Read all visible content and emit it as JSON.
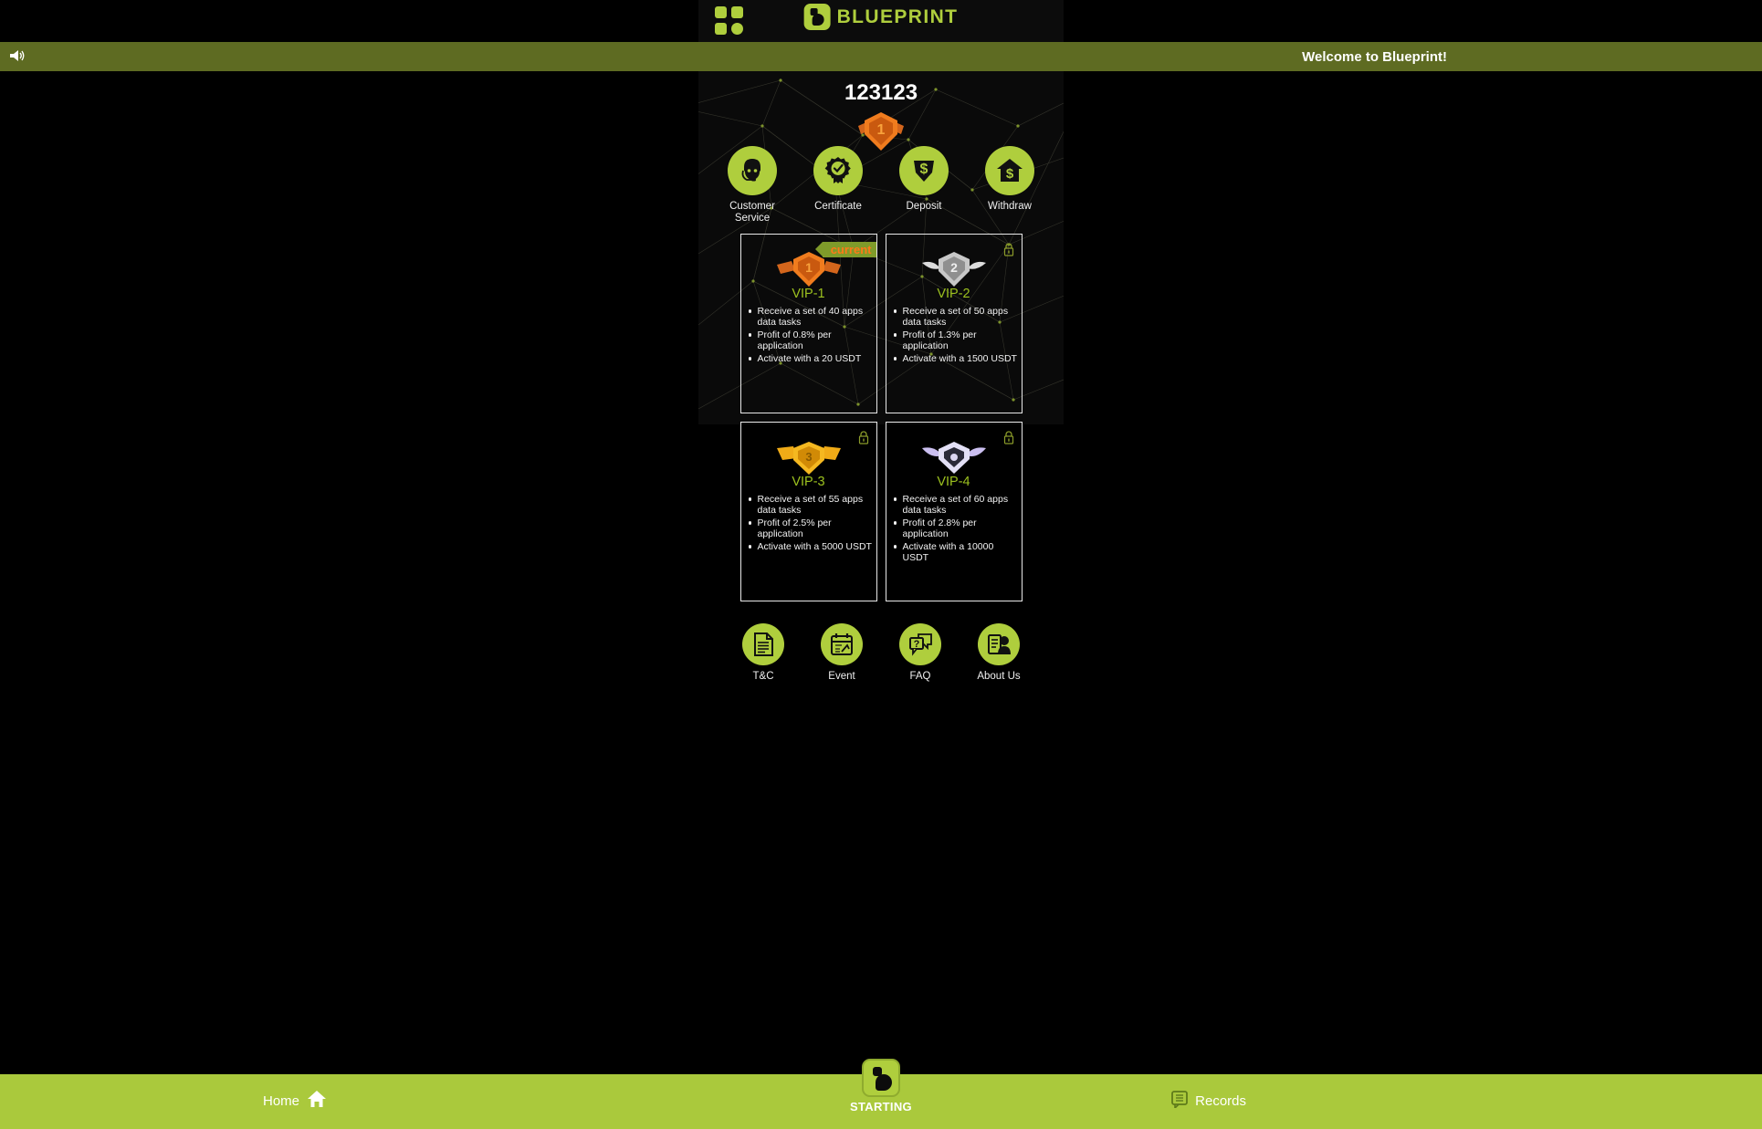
{
  "header": {
    "menu_icon": "grid-icon",
    "brand": "BLUEPRINT"
  },
  "notice": {
    "speaker_icon": "speaker-icon",
    "text": "Welcome to Blueprint!"
  },
  "profile": {
    "username": "123123",
    "vip_badge": "vip-1-badge"
  },
  "actions": [
    {
      "label": "Customer Service",
      "icon": "headset-agent-icon"
    },
    {
      "label": "Certificate",
      "icon": "certificate-seal-icon"
    },
    {
      "label": "Deposit",
      "icon": "deposit-arrow-dollar-icon"
    },
    {
      "label": "Withdraw",
      "icon": "withdraw-house-dollar-icon"
    }
  ],
  "vip_cards": [
    {
      "title": "VIP-1",
      "badge": "vip-1-badge",
      "status": "current",
      "status_label": "current",
      "locked": false,
      "benefits": [
        "Receive a set of 40 apps data tasks",
        "Profit of 0.8% per application",
        "Activate with a 20 USDT"
      ]
    },
    {
      "title": "VIP-2",
      "badge": "vip-2-badge",
      "status": "locked",
      "status_label": "",
      "locked": true,
      "benefits": [
        "Receive a set of 50 apps data tasks",
        "Profit of 1.3% per application",
        "Activate with a 1500 USDT"
      ]
    },
    {
      "title": "VIP-3",
      "badge": "vip-3-badge",
      "status": "locked",
      "status_label": "",
      "locked": true,
      "benefits": [
        "Receive a set of 55 apps data tasks",
        "Profit of 2.5% per application",
        "Activate with a 5000 USDT"
      ]
    },
    {
      "title": "VIP-4",
      "badge": "vip-4-badge",
      "status": "locked",
      "status_label": "",
      "locked": true,
      "benefits": [
        "Receive a set of 60 apps data tasks",
        "Profit of 2.8% per application",
        "Activate with a 10000 USDT"
      ]
    }
  ],
  "links": [
    {
      "label": "T&C",
      "icon": "document-icon"
    },
    {
      "label": "Event",
      "icon": "calendar-icon"
    },
    {
      "label": "FAQ",
      "icon": "question-chat-icon"
    },
    {
      "label": "About Us",
      "icon": "person-profile-icon"
    }
  ],
  "bottom_nav": {
    "home_label": "Home",
    "home_icon": "home-icon",
    "center_label": "STARTING",
    "center_icon": "blueprint-logo-icon",
    "records_label": "Records",
    "records_icon": "records-list-icon"
  },
  "colors": {
    "accent_green": "#afce3d",
    "nav_green": "#aac93c",
    "notice_olive": "#5e6b22",
    "vip_title": "#9cc11f",
    "current_orange": "#ff7a18",
    "background": "#000000"
  }
}
